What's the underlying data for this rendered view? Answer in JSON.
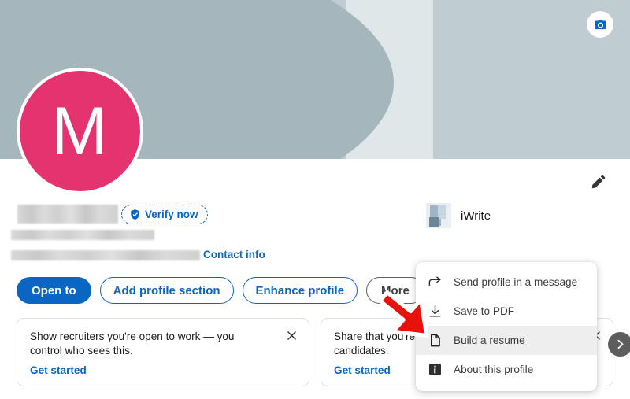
{
  "banner": {
    "camera_icon": "camera-icon",
    "colors": {
      "dark_band": "#a5b7bc",
      "mid_band": "#bfcdd2",
      "light_band": "#dfe7e9"
    }
  },
  "avatar": {
    "initial": "M",
    "color": "#e5336f"
  },
  "profile": {
    "edit_icon": "pencil-icon",
    "name_redacted": "",
    "headline_redacted": "",
    "location_redacted": "",
    "verify": {
      "label": "Verify now",
      "icon": "shield-check-icon",
      "color": "#0a66c2"
    },
    "contact_info_label": "Contact info"
  },
  "actions": [
    {
      "label": "Open to",
      "style": "primary",
      "name": "open-to-button"
    },
    {
      "label": "Add profile section",
      "style": "outline",
      "name": "add-profile-section-button"
    },
    {
      "label": "Enhance profile",
      "style": "outline",
      "name": "enhance-profile-button"
    },
    {
      "label": "More",
      "style": "grey",
      "name": "more-button"
    }
  ],
  "company": {
    "name": "iWrite",
    "logo_icon": "company-logo-icon"
  },
  "promos": [
    {
      "text": "Show recruiters you're open to work — you control who sees this.",
      "link": "Get started",
      "close_icon": "close-icon"
    },
    {
      "text": "Share that you're hiring and attract qualified candidates.",
      "link": "Get started",
      "close_icon": "close-icon"
    }
  ],
  "carousel": {
    "next_icon": "chevron-right-icon"
  },
  "dropdown": {
    "items": [
      {
        "label": "Send profile in a message",
        "icon": "share-arrow-icon",
        "highlighted": false
      },
      {
        "label": "Save to PDF",
        "icon": "download-icon",
        "highlighted": false
      },
      {
        "label": "Build a resume",
        "icon": "document-icon",
        "highlighted": true
      },
      {
        "label": "About this profile",
        "icon": "info-icon",
        "highlighted": false
      }
    ]
  },
  "annotation": {
    "arrow_color": "#e8120c",
    "arrow_target": "Build a resume"
  }
}
